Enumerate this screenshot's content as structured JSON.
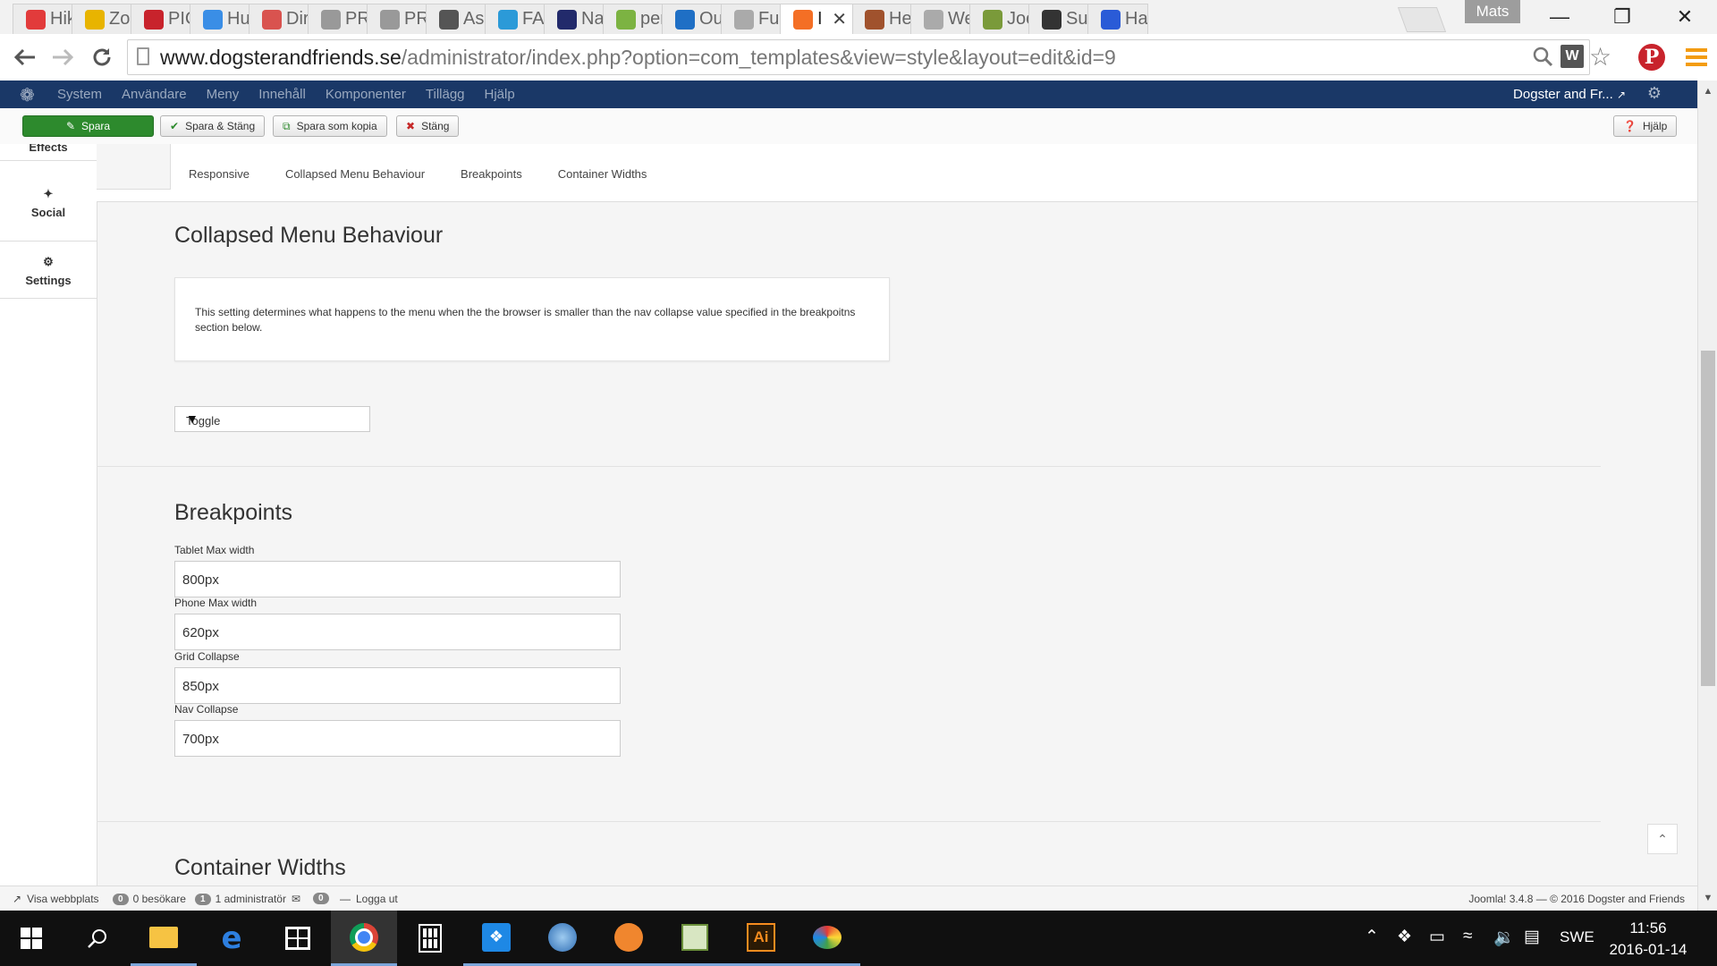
{
  "browser": {
    "tabs": [
      {
        "label": "Hik",
        "icon": "sun-logo-icon",
        "color": "#e23b3b"
      },
      {
        "label": "Zoo",
        "icon": "zoo-logo-icon",
        "color": "#e8b400"
      },
      {
        "label": "PICl",
        "icon": "pinterest-icon",
        "color": "#c8232c"
      },
      {
        "label": "Hur",
        "icon": "my-logo-icon",
        "color": "#3a8ee6"
      },
      {
        "label": "Dire",
        "icon": "heart-icon",
        "color": "#d9534f"
      },
      {
        "label": "PRI",
        "icon": "crown-icon",
        "color": "#999999"
      },
      {
        "label": "PRI",
        "icon": "crown-icon",
        "color": "#999999"
      },
      {
        "label": "Asc",
        "icon": "dm-logo-icon",
        "color": "#555555"
      },
      {
        "label": "FAC",
        "icon": "shield-icon",
        "color": "#2b9ad8"
      },
      {
        "label": "Nar",
        "icon": "n-logo-icon",
        "color": "#222a6b"
      },
      {
        "label": "perl",
        "icon": "chart-icon",
        "color": "#7cb342"
      },
      {
        "label": "Out",
        "icon": "outlook-icon",
        "color": "#1f6fc5"
      },
      {
        "label": "Full",
        "icon": "page-icon",
        "color": "#aaaaaa"
      },
      {
        "label": "I",
        "icon": "joomla-icon",
        "color": "#f46f25",
        "active": true
      },
      {
        "label": "Hen",
        "icon": "dog-icon",
        "color": "#a0522d"
      },
      {
        "label": "Wel",
        "icon": "page-icon",
        "color": "#aaaaaa"
      },
      {
        "label": "Joo",
        "icon": "vine-icon",
        "color": "#7a9a3a"
      },
      {
        "label": "Sun",
        "icon": "js-icon",
        "color": "#333333"
      },
      {
        "label": "Har",
        "icon": "square-blue-icon",
        "color": "#2a5bd7"
      }
    ],
    "profile_name": "Mats",
    "url_host": "www.dogsterandfriends.se",
    "url_path": "/administrator/index.php?option=com_templates&view=style&layout=edit&id=9"
  },
  "joomla": {
    "menu": [
      "System",
      "Användare",
      "Meny",
      "Innehåll",
      "Komponenter",
      "Tillägg",
      "Hjälp"
    ],
    "site_name": "Dogster and Fr...",
    "toolbar": {
      "save": "Spara",
      "save_close": "Spara & Stäng",
      "save_copy": "Spara som kopia",
      "close": "Stäng",
      "help": "Hjälp"
    },
    "leftnav": [
      {
        "label": "Effects"
      },
      {
        "label": "Social"
      },
      {
        "label": "Settings"
      }
    ],
    "tabs": [
      "Responsive",
      "Collapsed Menu Behaviour",
      "Breakpoints",
      "Container Widths"
    ],
    "collapsed": {
      "title": "Collapsed Menu Behaviour",
      "description": "This setting determines what happens to the menu when the the browser is smaller than the nav collapse value specified in the breakpoitns section below.",
      "selected": "Toggle"
    },
    "breakpoints": {
      "title": "Breakpoints",
      "fields": [
        {
          "label": "Tablet Max width",
          "value": "800px"
        },
        {
          "label": "Phone Max width",
          "value": "620px"
        },
        {
          "label": "Grid Collapse",
          "value": "850px"
        },
        {
          "label": "Nav Collapse",
          "value": "700px"
        }
      ]
    },
    "container_widths_title": "Container Widths",
    "status": {
      "view_site": "Visa webbplats",
      "visitors_count": "0",
      "visitors_label": "besökare",
      "admins_count": "1",
      "admins_label": "administratör",
      "messages_count": "0",
      "logout": "Logga ut",
      "footer": "Joomla! 3.4.8  —  © 2016 Dogster and Friends"
    }
  },
  "taskbar": {
    "language": "SWE",
    "time": "11:56",
    "date": "2016-01-14"
  },
  "colors": {
    "joomla_nav": "#1a3867",
    "save_green": "#2d8a2d",
    "taskbar": "#101010"
  }
}
